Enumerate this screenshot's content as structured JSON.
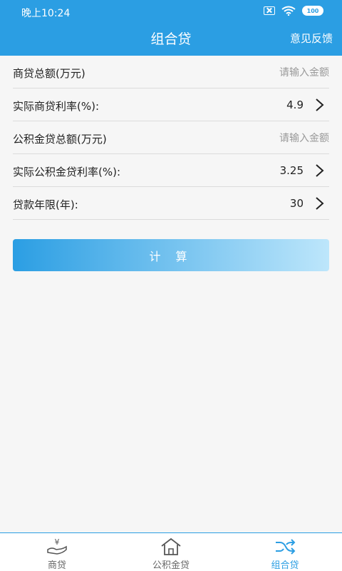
{
  "status": {
    "time": "晚上10:24",
    "battery": "100"
  },
  "header": {
    "title": "组合贷",
    "feedback": "意见反馈"
  },
  "form": {
    "commercial_amount": {
      "label": "商贷总额(万元)",
      "placeholder": "请输入金额"
    },
    "commercial_rate": {
      "label": "实际商贷利率(%):",
      "value": "4.9"
    },
    "fund_amount": {
      "label": "公积金贷总额(万元)",
      "placeholder": "请输入金额"
    },
    "fund_rate": {
      "label": "实际公积金贷利率(%):",
      "value": "3.25"
    },
    "years": {
      "label": "贷款年限(年):",
      "value": "30"
    }
  },
  "calculate_label": "计 算",
  "tabs": [
    {
      "label": "商贷",
      "icon": "yen-hand-icon",
      "active": false
    },
    {
      "label": "公积金贷",
      "icon": "house-icon",
      "active": false
    },
    {
      "label": "组合贷",
      "icon": "shuffle-icon",
      "active": true
    }
  ],
  "colors": {
    "primary": "#2b9ee3",
    "background": "#f6f6f6"
  }
}
